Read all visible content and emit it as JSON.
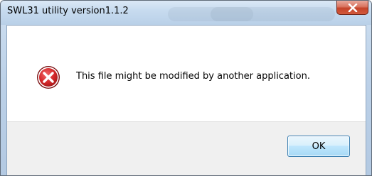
{
  "window": {
    "title": "SWL31 utility version1.1.2",
    "close_icon": "close-icon"
  },
  "dialog": {
    "icon": "error-icon",
    "message": "This file might be modified by another application.",
    "ok_label": "OK"
  },
  "colors": {
    "error_red": "#d4282a",
    "close_button_red": "#c5432a",
    "button_border": "#3c7fb1"
  }
}
